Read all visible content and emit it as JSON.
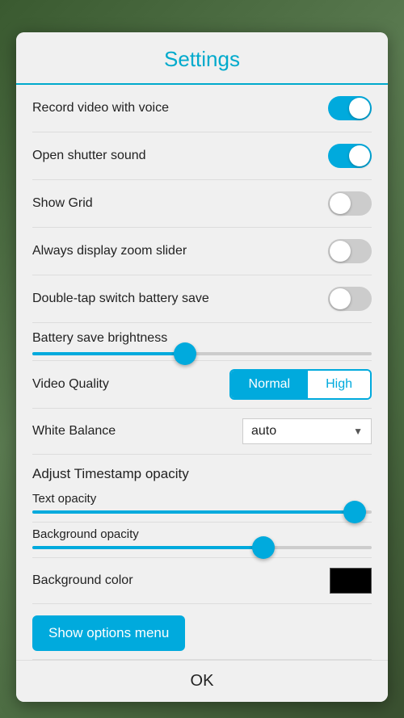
{
  "dialog": {
    "title": "Settings"
  },
  "settings": {
    "record_video_label": "Record video with voice",
    "record_video_on": true,
    "open_shutter_label": "Open shutter sound",
    "open_shutter_on": true,
    "show_grid_label": "Show Grid",
    "show_grid_on": false,
    "always_display_label": "Always display zoom slider",
    "always_display_on": false,
    "double_tap_label": "Double-tap switch battery save",
    "double_tap_on": false,
    "battery_brightness_label": "Battery save brightness",
    "battery_brightness_pct": 45,
    "video_quality_label": "Video Quality",
    "video_quality_normal": "Normal",
    "video_quality_high": "High",
    "video_quality_selected": "Normal",
    "white_balance_label": "White Balance",
    "white_balance_value": "auto",
    "timestamp_heading": "Adjust Timestamp opacity",
    "text_opacity_label": "Text opacity",
    "text_opacity_pct": 95,
    "bg_opacity_label": "Background opacity",
    "bg_opacity_pct": 68,
    "bg_color_label": "Background color",
    "options_menu_label": "Show options menu",
    "ok_label": "OK"
  }
}
